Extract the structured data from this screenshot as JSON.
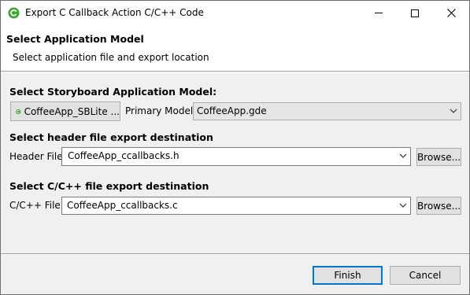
{
  "window": {
    "title": "Export C Callback Action C/C++ Code",
    "icon": "storyboard-icon"
  },
  "banner": {
    "title": "Select Application Model",
    "subtitle": "Select application file and export location"
  },
  "model_section": {
    "title": "Select Storyboard Application Model:",
    "app_button_label": "CoffeeApp_SBLite ...",
    "primary_model_label": "Primary Model:",
    "primary_model_value": "CoffeeApp.gde"
  },
  "header_section": {
    "title": "Select header file export destination",
    "field_label": "Header File:",
    "field_value": "CoffeeApp_ccallbacks.h",
    "browse_label": "Browse..."
  },
  "c_section": {
    "title": "Select C/C++ file export destination",
    "field_label": "C/C++ File:",
    "field_value": "CoffeeApp_ccallbacks.c",
    "browse_label": "Browse..."
  },
  "footer": {
    "finish_label": "Finish",
    "cancel_label": "Cancel"
  },
  "colors": {
    "accent": "#0078d7",
    "icon_green": "#3fa535"
  }
}
